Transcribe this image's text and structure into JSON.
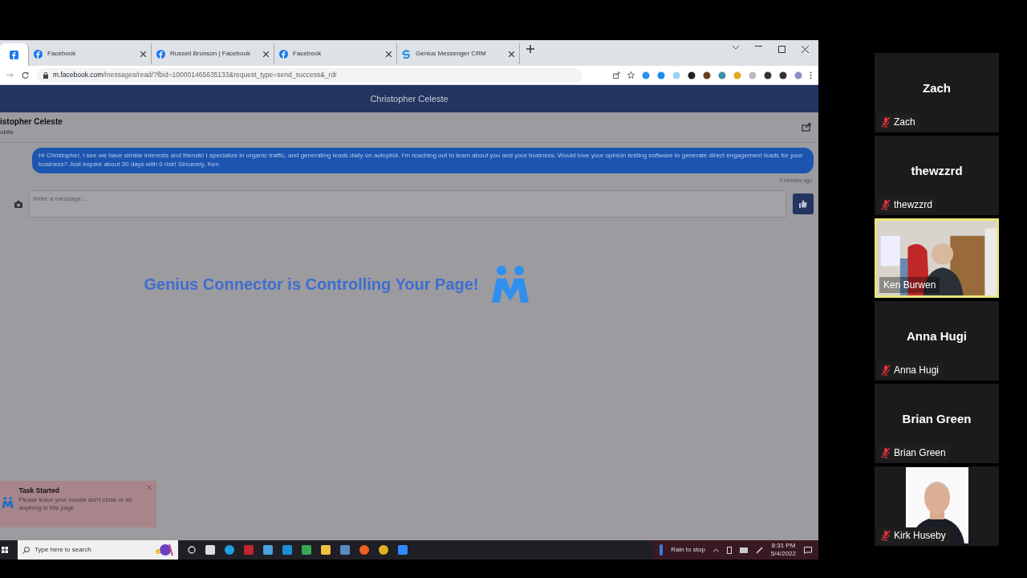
{
  "browser": {
    "tabs": [
      {
        "kind": "pinned",
        "selected": true
      },
      {
        "kind": "facebook",
        "label": "Facebook",
        "selected": false
      },
      {
        "kind": "facebook",
        "label": "Russell Brunson | Facebook",
        "selected": false
      },
      {
        "kind": "facebook",
        "label": "Facebook",
        "selected": false
      },
      {
        "kind": "genius",
        "label": "Genius Messenger CRM",
        "selected": false
      }
    ],
    "url_host": "m.facebook.com",
    "url_path": "/messages/read/?fbid=100001465635133&request_type=send_success&_rdr"
  },
  "page": {
    "header_title": "Christopher Celeste",
    "contact_name": "istopher Celeste",
    "contact_status": "obile",
    "messages": [
      {
        "text": "Hi Christopher, I see we have similar interests and friends! I specialize in organic traffic, and generating leads daily on autopilot. I'm reaching out to learn about you and your business. Would love your opinion testing software to generate direct engagement leads for your business? Just inquire about 30 days with 0 risk! Sincerely, Ken",
        "time": "3 minutes ago"
      }
    ],
    "composer": {
      "placeholder": "Write a message..."
    },
    "overlay_text": "Genius Connector is Controlling Your Page!",
    "toast": {
      "title": "Task Started",
      "body": "Please leave your mouse don't close or do anything in this page"
    }
  },
  "taskbar": {
    "search_placeholder": "Type here to search",
    "weather": "Rain to stop",
    "time": "8:31 PM",
    "date": "5/4/2022"
  },
  "participants": [
    {
      "kind": "name",
      "name": "Zach",
      "label": "Zach",
      "muted": true,
      "active": false
    },
    {
      "kind": "name",
      "name": "thewzzrd",
      "label": "thewzzrd",
      "muted": true,
      "active": false
    },
    {
      "kind": "video",
      "label": "Ken Burwen",
      "muted": false,
      "active": true
    },
    {
      "kind": "name",
      "name": "Anna Hugi",
      "label": "Anna Hugi",
      "muted": true,
      "active": false
    },
    {
      "kind": "name",
      "name": "Brian Green",
      "label": "Brian Green",
      "muted": true,
      "active": false
    },
    {
      "label": "Kirk Huseby",
      "muted": true,
      "active": false
    }
  ]
}
